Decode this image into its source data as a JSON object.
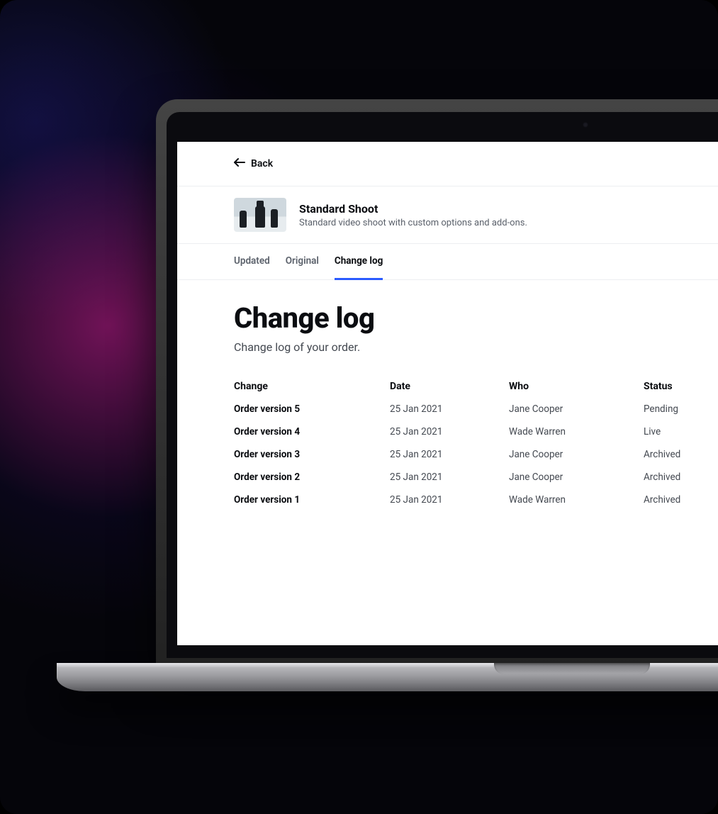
{
  "back_label": "Back",
  "product": {
    "title": "Standard Shoot",
    "description": "Standard video shoot with custom options and add-ons."
  },
  "tabs": [
    {
      "label": "Updated",
      "active": false
    },
    {
      "label": "Original",
      "active": false
    },
    {
      "label": "Change log",
      "active": true
    }
  ],
  "page": {
    "title": "Change log",
    "subtitle": "Change log of your order."
  },
  "columns": {
    "change": "Change",
    "date": "Date",
    "who": "Who",
    "status": "Status"
  },
  "rows": [
    {
      "change": "Order version 5",
      "date": "25 Jan 2021",
      "who": "Jane Cooper",
      "status": "Pending"
    },
    {
      "change": "Order version 4",
      "date": "25 Jan 2021",
      "who": "Wade Warren",
      "status": "Live"
    },
    {
      "change": "Order version 3",
      "date": "25 Jan 2021",
      "who": "Jane Cooper",
      "status": "Archived"
    },
    {
      "change": "Order version 2",
      "date": "25 Jan 2021",
      "who": "Jane Cooper",
      "status": "Archived"
    },
    {
      "change": "Order version 1",
      "date": "25 Jan 2021",
      "who": "Wade Warren",
      "status": "Archived"
    }
  ]
}
